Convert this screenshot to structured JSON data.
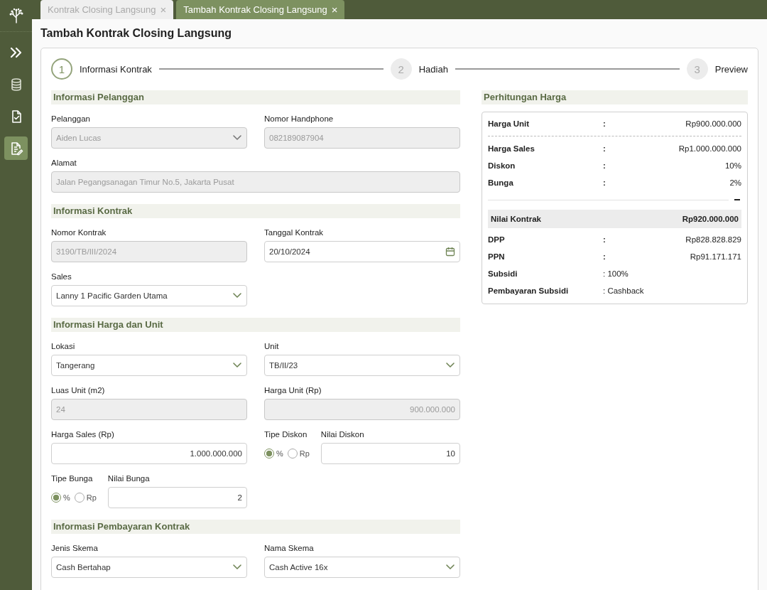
{
  "tabs": [
    {
      "label": "Kontrak Closing Langsung",
      "close": "×",
      "selected": false
    },
    {
      "label": "Tambah Kontrak Closing Langsung",
      "close": "×",
      "selected": true
    }
  ],
  "sidebar": {
    "items": [
      {
        "kind": "expand",
        "selected": false
      },
      {
        "kind": "database",
        "selected": false
      },
      {
        "kind": "file-check",
        "selected": false
      },
      {
        "kind": "file-edit",
        "selected": true
      }
    ]
  },
  "page_title": "Tambah Kontrak Closing Langsung",
  "steps": [
    {
      "number": "1",
      "label": "Informasi Kontrak",
      "active": true
    },
    {
      "number": "2",
      "label": "Hadiah",
      "active": false
    },
    {
      "number": "3",
      "label": "Preview",
      "active": false
    }
  ],
  "sections": [
    {
      "title": "Informasi Pelanggan",
      "rows": [
        {
          "columns": [
            [
              {
                "kind": "select",
                "label": "Pelanggan",
                "value": "Aiden Lucas",
                "disabled": true
              }
            ],
            [
              {
                "kind": "text",
                "label": "Nomor Handphone",
                "value": "082189087904",
                "disabled": true
              }
            ]
          ]
        },
        {
          "columns": [
            [
              {
                "kind": "text",
                "label": "Alamat",
                "value": "Jalan Pegangsanagan Timur No.5, Jakarta Pusat",
                "disabled": true,
                "wide": true
              }
            ]
          ]
        }
      ]
    },
    {
      "title": "Informasi Kontrak",
      "rows": [
        {
          "columns": [
            [
              {
                "kind": "text",
                "label": "Nomor Kontrak",
                "value": "3190/TB/III/2024",
                "disabled": true
              }
            ],
            [
              {
                "kind": "date",
                "label": "Tanggal Kontrak",
                "value": "20/10/2024",
                "disabled": false
              }
            ]
          ]
        },
        {
          "columns": [
            [
              {
                "kind": "select",
                "label": "Sales",
                "value": "Lanny 1 Pacific Garden Utama",
                "disabled": false
              }
            ]
          ]
        }
      ]
    },
    {
      "title": "Informasi Harga dan Unit",
      "rows": [
        {
          "columns": [
            [
              {
                "kind": "select",
                "label": "Lokasi",
                "value": "Tangerang",
                "disabled": false
              }
            ],
            [
              {
                "kind": "select",
                "label": "Unit",
                "value": "TB/II/23",
                "disabled": false
              }
            ]
          ]
        },
        {
          "columns": [
            [
              {
                "kind": "text",
                "label": "Luas Unit (m2)",
                "value": "24",
                "disabled": true
              }
            ],
            [
              {
                "kind": "number",
                "label": "Harga Unit (Rp)",
                "value": "900.000.000",
                "disabled": true
              }
            ]
          ]
        },
        {
          "columns": [
            [
              {
                "kind": "number",
                "label": "Harga Sales (Rp)",
                "value": "1.000.000.000",
                "disabled": false
              }
            ],
            [
              {
                "kind": "radio",
                "label": "Tipe Diskon",
                "options": [
                  {
                    "label": "%",
                    "selected": true
                  },
                  {
                    "label": "Rp",
                    "selected": false
                  }
                ]
              },
              {
                "kind": "number",
                "label": "Nilai Diskon",
                "value": "10",
                "disabled": false
              }
            ]
          ]
        },
        {
          "columns": [
            [
              {
                "kind": "radio",
                "label": "Tipe Bunga",
                "options": [
                  {
                    "label": "%",
                    "selected": true
                  },
                  {
                    "label": "Rp",
                    "selected": false
                  }
                ]
              },
              {
                "kind": "number",
                "label": "Nilai Bunga",
                "value": "2",
                "disabled": false
              }
            ]
          ]
        }
      ]
    },
    {
      "title": "Informasi Pembayaran Kontrak",
      "rows": [
        {
          "columns": [
            [
              {
                "kind": "select",
                "label": "Jenis Skema",
                "value": "Cash Bertahap",
                "disabled": false
              }
            ],
            [
              {
                "kind": "select",
                "label": "Nama Skema",
                "value": "Cash Active 16x",
                "disabled": false
              }
            ]
          ]
        }
      ]
    }
  ],
  "summary": {
    "title": "Perhitungan Harga",
    "rows": [
      {
        "kind": "pair",
        "label": "Harga Unit",
        "colon": ":",
        "value": "Rp900.000.000"
      },
      {
        "kind": "dashed-divider"
      },
      {
        "kind": "pair",
        "label": "Harga Sales",
        "colon": ":",
        "value": "Rp1.000.000.000"
      },
      {
        "kind": "pair",
        "label": "Diskon",
        "colon": ":",
        "value": "10%"
      },
      {
        "kind": "pair",
        "label": "Bunga",
        "colon": ":",
        "value": "2%"
      },
      {
        "kind": "minus-divider"
      },
      {
        "kind": "total",
        "label": "Nilai Kontrak",
        "value": "Rp920.000.000"
      },
      {
        "kind": "pair",
        "label": "DPP",
        "colon": ":",
        "value": "Rp828.828.829"
      },
      {
        "kind": "pair",
        "label": "PPN",
        "colon": ":",
        "value": "Rp91.171.171"
      },
      {
        "kind": "note",
        "label": "Subsidi",
        "value": ": 100%"
      },
      {
        "kind": "note",
        "label": "Pembayaran Subsidi",
        "value": ": Cashback"
      }
    ]
  }
}
